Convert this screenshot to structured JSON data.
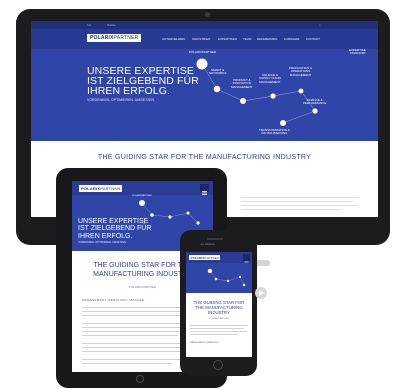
{
  "brand": {
    "logo_a": "POLARIX",
    "logo_b": "PARTNER"
  },
  "desktop": {
    "topbar": {
      "left_icons": "f  in",
      "search_label": "Suche",
      "right_icon": "⌕"
    },
    "nav": [
      "UNTERNEHMEN",
      "INDUSTRIEN",
      "EXPERTISEN",
      "TEAM",
      "REFERENZEN",
      "KARRIERE",
      "KONTAKT"
    ],
    "corner_link": "EXPERTISE\nSTANDORT",
    "hero_title": "UNSERE EXPERTISE\nIST ZIELGEBEND FÜR\nIHREN ERFOLG.",
    "hero_subtitle": "VORDENKEN. OPTIMIEREN. UMSETZEN.",
    "star_brand": "POLARIXPARTNER",
    "stars": [
      {
        "label": "SMART &\nNETWORKS"
      },
      {
        "label": "PRODUCT &\nINNOVATION\nMANAGEMENT"
      },
      {
        "label": "SOURCE &\nSUPPLY CHAIN\nMANAGEMENT"
      },
      {
        "label": "PRODUCTION &\nOPERATIONS\nMANAGEMENT"
      },
      {
        "label": "FINANCE &\nPERFORMANCE"
      },
      {
        "label": "TRANSFORMATION &\nDIGITALISIERUNG"
      }
    ],
    "guide_title": "THE GUIDING STAR FOR THE MANUFACTURING INDUSTRY"
  },
  "tablet": {
    "hero_title": "UNSERE EXPERTISE\nIST ZIELGEBEND FÜR\nIHREN ERFOLG.",
    "hero_subtitle": "VORDENKEN. OPTIMIEREN. UMSETZEN.",
    "star_brand": "POLARIXPARTNER",
    "guide_title": "THE GUIDING STAR FOR THE\nMANUFACTURING INDUSTRY",
    "small_label": "POLARIXPARTNER",
    "mgmt_label": "MANAGEMENT. BERATUNG. MACHEN."
  },
  "phone": {
    "status": "•••••  Vodafone",
    "guide_title": "THE GUIDING STAR FOR\nTHE MANUFACTURING\nINDUSTRY",
    "small_label": "POLARIXPARTNER",
    "mgmt_label": "MANAGEMENT. BERATUNG."
  },
  "colors": {
    "navy": "#283a94",
    "hero_blue": "#2f45a8",
    "headline": "#2c3f99"
  },
  "icons": [
    "camera-icon",
    "menu-icon",
    "search-icon",
    "home-button-icon",
    "next-arrow-icon"
  ]
}
